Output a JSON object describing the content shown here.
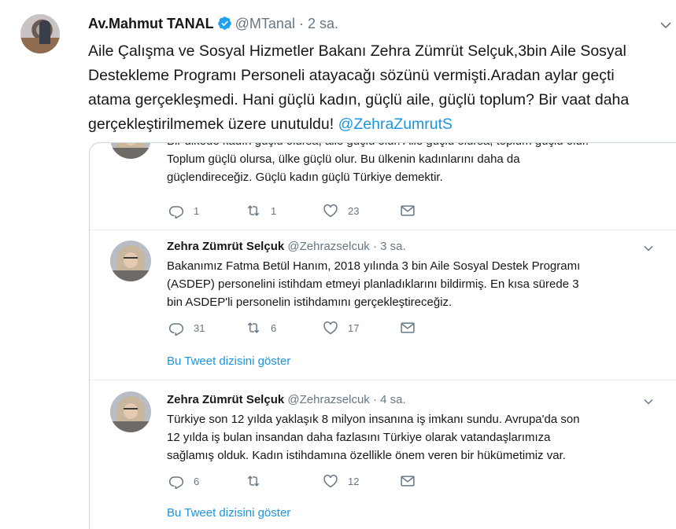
{
  "main_tweet": {
    "name": "Av.Mahmut TANAL",
    "handle": "@MTanal",
    "separator": "·",
    "time": "2 sa.",
    "text_lines": [
      "Aile Çalışma ve Sosyal Hizmetler Bakanı Zehra Zümrüt Selçuk,3bin Aile Sosyal",
      "Destekleme Programı Personeli atayacağı sözünü vermişti.Aradan aylar geçti",
      "atama gerçekleşmedi. Hani güçlü kadın, güçlü aile, güçlü toplum? Bir vaat daha",
      "gerçekleştirilmemek üzere unutuldu! "
    ],
    "mention": "@ZehraZumrutS"
  },
  "thread": {
    "tweet1": {
      "cutoff_line": "Bir ülkede kadın güçlü olursa, aile güçlü olur. Aile güçlü olursa, toplum güçlü olur.",
      "text_lines": [
        "Toplum güçlü olursa, ülke güçlü olur. Bu ülkenin kadınlarını daha da",
        "güçlendireceğiz. Güçlü kadın güçlü Türkiye demektir."
      ],
      "replies": "1",
      "retweets": "1",
      "likes": "23"
    },
    "tweet2": {
      "name": "Zehra Zümrüt Selçuk",
      "handle": "@Zehrazselcuk · 3 sa.",
      "text_lines": [
        "Bakanımız Fatma Betül Hanım, 2018 yılında 3 bin Aile Sosyal Destek Programı",
        "(ASDEP) personelini istihdam etmeyi planladıklarını bildirmiş. En kısa sürede 3",
        "bin ASDEP'li personelin istihdamını gerçekleştireceğiz."
      ],
      "replies": "31",
      "retweets": "6",
      "likes": "17",
      "show_thread": "Bu Tweet dizisini göster"
    },
    "tweet3": {
      "name": "Zehra Zümrüt Selçuk",
      "handle": "@Zehrazselcuk · 4 sa.",
      "text_lines": [
        "Türkiye son 12 yılda yaklaşık 8 milyon insanına iş imkanı sundu. Avrupa'da son",
        "12 yılda iş bulan insandan daha fazlasını Türkiye olarak vatandaşlarımıza",
        "sağlamış olduk. Kadın istihdamına özellikle önem veren bir hükümetimiz var."
      ],
      "replies": "6",
      "retweets": "",
      "likes": "12",
      "show_thread": "Bu Tweet dizisini göster"
    }
  },
  "colors": {
    "text": "#14171a",
    "secondary": "#657786",
    "link": "#1b95e0",
    "border": "#ccd6dd",
    "verified": "#1da1f2"
  },
  "icons": [
    "verified-badge-icon",
    "chevron-down-icon",
    "reply-icon",
    "retweet-icon",
    "like-icon",
    "direct-message-icon"
  ]
}
